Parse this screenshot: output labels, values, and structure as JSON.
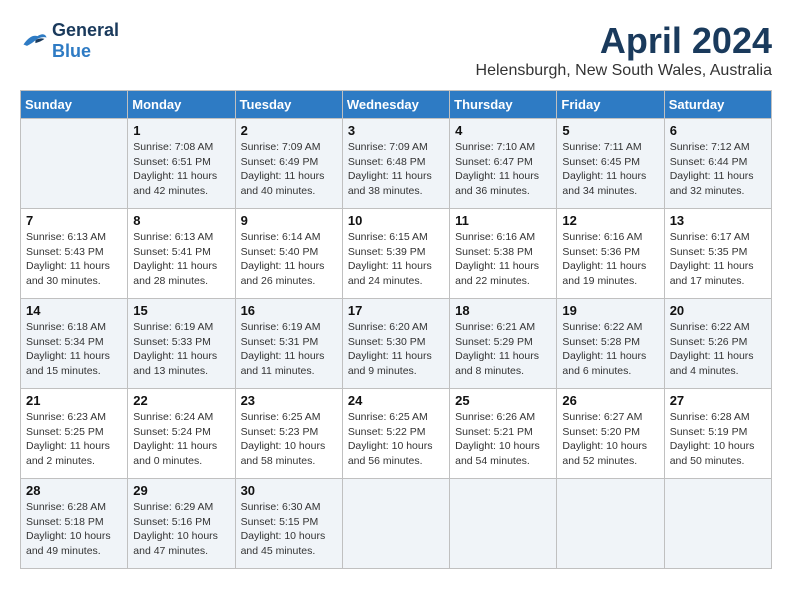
{
  "logo": {
    "line1": "General",
    "line2": "Blue"
  },
  "title": "April 2024",
  "location": "Helensburgh, New South Wales, Australia",
  "weekdays": [
    "Sunday",
    "Monday",
    "Tuesday",
    "Wednesday",
    "Thursday",
    "Friday",
    "Saturday"
  ],
  "weeks": [
    [
      {
        "day": "",
        "sunrise": "",
        "sunset": "",
        "daylight": ""
      },
      {
        "day": "1",
        "sunrise": "Sunrise: 7:08 AM",
        "sunset": "Sunset: 6:51 PM",
        "daylight": "Daylight: 11 hours and 42 minutes."
      },
      {
        "day": "2",
        "sunrise": "Sunrise: 7:09 AM",
        "sunset": "Sunset: 6:49 PM",
        "daylight": "Daylight: 11 hours and 40 minutes."
      },
      {
        "day": "3",
        "sunrise": "Sunrise: 7:09 AM",
        "sunset": "Sunset: 6:48 PM",
        "daylight": "Daylight: 11 hours and 38 minutes."
      },
      {
        "day": "4",
        "sunrise": "Sunrise: 7:10 AM",
        "sunset": "Sunset: 6:47 PM",
        "daylight": "Daylight: 11 hours and 36 minutes."
      },
      {
        "day": "5",
        "sunrise": "Sunrise: 7:11 AM",
        "sunset": "Sunset: 6:45 PM",
        "daylight": "Daylight: 11 hours and 34 minutes."
      },
      {
        "day": "6",
        "sunrise": "Sunrise: 7:12 AM",
        "sunset": "Sunset: 6:44 PM",
        "daylight": "Daylight: 11 hours and 32 minutes."
      }
    ],
    [
      {
        "day": "7",
        "sunrise": "Sunrise: 6:13 AM",
        "sunset": "Sunset: 5:43 PM",
        "daylight": "Daylight: 11 hours and 30 minutes."
      },
      {
        "day": "8",
        "sunrise": "Sunrise: 6:13 AM",
        "sunset": "Sunset: 5:41 PM",
        "daylight": "Daylight: 11 hours and 28 minutes."
      },
      {
        "day": "9",
        "sunrise": "Sunrise: 6:14 AM",
        "sunset": "Sunset: 5:40 PM",
        "daylight": "Daylight: 11 hours and 26 minutes."
      },
      {
        "day": "10",
        "sunrise": "Sunrise: 6:15 AM",
        "sunset": "Sunset: 5:39 PM",
        "daylight": "Daylight: 11 hours and 24 minutes."
      },
      {
        "day": "11",
        "sunrise": "Sunrise: 6:16 AM",
        "sunset": "Sunset: 5:38 PM",
        "daylight": "Daylight: 11 hours and 22 minutes."
      },
      {
        "day": "12",
        "sunrise": "Sunrise: 6:16 AM",
        "sunset": "Sunset: 5:36 PM",
        "daylight": "Daylight: 11 hours and 19 minutes."
      },
      {
        "day": "13",
        "sunrise": "Sunrise: 6:17 AM",
        "sunset": "Sunset: 5:35 PM",
        "daylight": "Daylight: 11 hours and 17 minutes."
      }
    ],
    [
      {
        "day": "14",
        "sunrise": "Sunrise: 6:18 AM",
        "sunset": "Sunset: 5:34 PM",
        "daylight": "Daylight: 11 hours and 15 minutes."
      },
      {
        "day": "15",
        "sunrise": "Sunrise: 6:19 AM",
        "sunset": "Sunset: 5:33 PM",
        "daylight": "Daylight: 11 hours and 13 minutes."
      },
      {
        "day": "16",
        "sunrise": "Sunrise: 6:19 AM",
        "sunset": "Sunset: 5:31 PM",
        "daylight": "Daylight: 11 hours and 11 minutes."
      },
      {
        "day": "17",
        "sunrise": "Sunrise: 6:20 AM",
        "sunset": "Sunset: 5:30 PM",
        "daylight": "Daylight: 11 hours and 9 minutes."
      },
      {
        "day": "18",
        "sunrise": "Sunrise: 6:21 AM",
        "sunset": "Sunset: 5:29 PM",
        "daylight": "Daylight: 11 hours and 8 minutes."
      },
      {
        "day": "19",
        "sunrise": "Sunrise: 6:22 AM",
        "sunset": "Sunset: 5:28 PM",
        "daylight": "Daylight: 11 hours and 6 minutes."
      },
      {
        "day": "20",
        "sunrise": "Sunrise: 6:22 AM",
        "sunset": "Sunset: 5:26 PM",
        "daylight": "Daylight: 11 hours and 4 minutes."
      }
    ],
    [
      {
        "day": "21",
        "sunrise": "Sunrise: 6:23 AM",
        "sunset": "Sunset: 5:25 PM",
        "daylight": "Daylight: 11 hours and 2 minutes."
      },
      {
        "day": "22",
        "sunrise": "Sunrise: 6:24 AM",
        "sunset": "Sunset: 5:24 PM",
        "daylight": "Daylight: 11 hours and 0 minutes."
      },
      {
        "day": "23",
        "sunrise": "Sunrise: 6:25 AM",
        "sunset": "Sunset: 5:23 PM",
        "daylight": "Daylight: 10 hours and 58 minutes."
      },
      {
        "day": "24",
        "sunrise": "Sunrise: 6:25 AM",
        "sunset": "Sunset: 5:22 PM",
        "daylight": "Daylight: 10 hours and 56 minutes."
      },
      {
        "day": "25",
        "sunrise": "Sunrise: 6:26 AM",
        "sunset": "Sunset: 5:21 PM",
        "daylight": "Daylight: 10 hours and 54 minutes."
      },
      {
        "day": "26",
        "sunrise": "Sunrise: 6:27 AM",
        "sunset": "Sunset: 5:20 PM",
        "daylight": "Daylight: 10 hours and 52 minutes."
      },
      {
        "day": "27",
        "sunrise": "Sunrise: 6:28 AM",
        "sunset": "Sunset: 5:19 PM",
        "daylight": "Daylight: 10 hours and 50 minutes."
      }
    ],
    [
      {
        "day": "28",
        "sunrise": "Sunrise: 6:28 AM",
        "sunset": "Sunset: 5:18 PM",
        "daylight": "Daylight: 10 hours and 49 minutes."
      },
      {
        "day": "29",
        "sunrise": "Sunrise: 6:29 AM",
        "sunset": "Sunset: 5:16 PM",
        "daylight": "Daylight: 10 hours and 47 minutes."
      },
      {
        "day": "30",
        "sunrise": "Sunrise: 6:30 AM",
        "sunset": "Sunset: 5:15 PM",
        "daylight": "Daylight: 10 hours and 45 minutes."
      },
      {
        "day": "",
        "sunrise": "",
        "sunset": "",
        "daylight": ""
      },
      {
        "day": "",
        "sunrise": "",
        "sunset": "",
        "daylight": ""
      },
      {
        "day": "",
        "sunrise": "",
        "sunset": "",
        "daylight": ""
      },
      {
        "day": "",
        "sunrise": "",
        "sunset": "",
        "daylight": ""
      }
    ]
  ]
}
